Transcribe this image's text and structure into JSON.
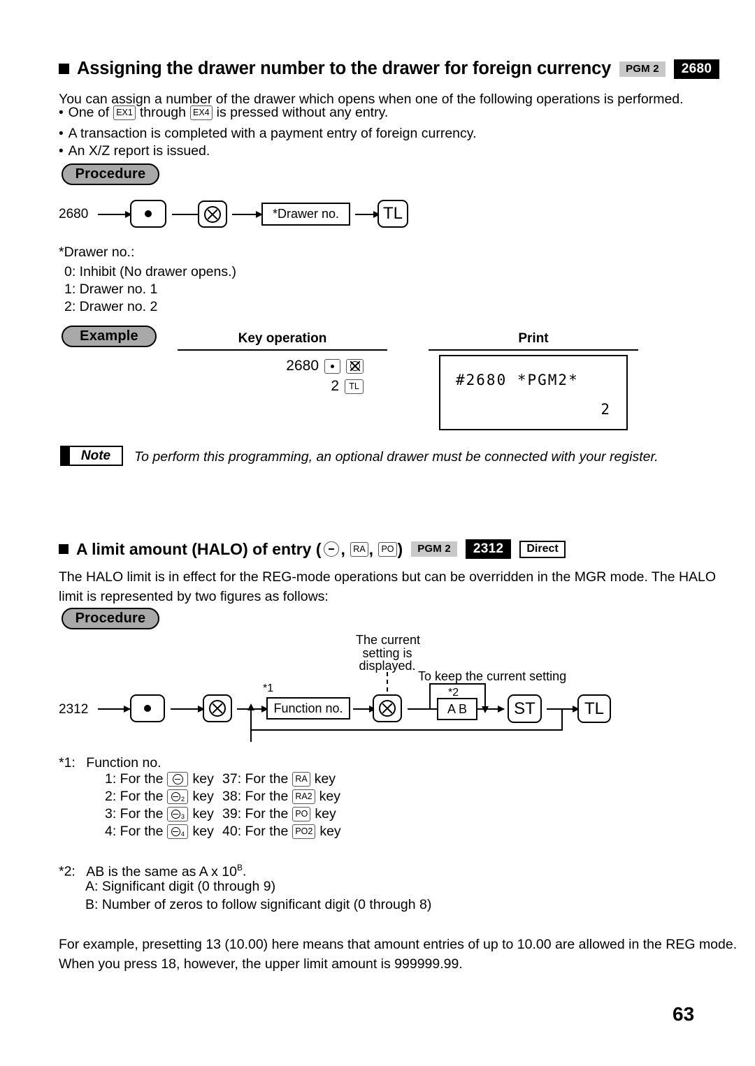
{
  "page": {
    "number": "63"
  },
  "section1": {
    "heading": "Assigning the drawer number to the drawer for foreign currency",
    "badge_mode": "PGM 2",
    "badge_code": "2680",
    "intro": "You can assign a number of the drawer which opens when one of the following operations is performed.",
    "bullets": [
      {
        "pre": "One of",
        "key1": "EX1",
        "mid": "through",
        "key2": "EX4",
        "post": "is pressed without any entry."
      },
      {
        "pre": "A transaction is completed with a payment entry of foreign currency."
      },
      {
        "pre": "An X/Z report is issued."
      }
    ],
    "procedure_label": "Procedure",
    "flow": {
      "start": "2680",
      "node_dot": "dot-key",
      "node_multiply": "multiply-key",
      "node_entry": "*Drawer no.",
      "node_tl": "TL"
    },
    "drawer_note_title": "*Drawer no.:",
    "drawer_options": [
      "0: Inhibit (No drawer opens.)",
      "1: Drawer no. 1",
      "2: Drawer no. 2"
    ],
    "example_label": "Example",
    "col_key_operation": "Key operation",
    "col_print": "Print",
    "key_operation": {
      "row1_value": "2680",
      "row1_key1": "•",
      "row1_key2": "⊗",
      "row2_value": "2",
      "row2_key1": "TL"
    },
    "print": {
      "line1": "#2680 *PGM2*",
      "line2": "2"
    },
    "note_label": "Note",
    "note_text": "To perform this programming, an optional drawer must be connected with your register."
  },
  "section2": {
    "heading_pre": "A limit amount (HALO) of entry (",
    "heading_keys": [
      "minus-key",
      "RA",
      "PO"
    ],
    "heading_post": ")",
    "badge_mode": "PGM 2",
    "badge_code": "2312",
    "badge_direct": "Direct",
    "intro_line1": "The HALO limit is in effect for the REG-mode operations but can be overridden in the MGR mode. The HALO",
    "intro_line2": "limit is represented by two figures as follows:",
    "procedure_label": "Procedure",
    "flow": {
      "start": "2312",
      "annotation_current": [
        "The current",
        "setting is",
        "displayed."
      ],
      "annotation_keep": "To keep the current setting",
      "mark1": "*1",
      "mark2": "*2",
      "node_function": "Function no.",
      "node_ab": "A B",
      "node_st": "ST",
      "node_tl": "TL"
    },
    "fn_title_mark": "*1:",
    "fn_title": "Function no.",
    "fn_left": [
      {
        "num": "1: For the",
        "key": "minus",
        "sub": "",
        "tail": "key"
      },
      {
        "num": "2: For the",
        "key": "minus",
        "sub": "2",
        "tail": "key"
      },
      {
        "num": "3: For the",
        "key": "minus",
        "sub": "3",
        "tail": "key"
      },
      {
        "num": "4: For the",
        "key": "minus",
        "sub": "4",
        "tail": "key"
      }
    ],
    "fn_right": [
      {
        "num": "37: For the",
        "key": "RA",
        "tail": "key"
      },
      {
        "num": "38: For the",
        "key": "RA2",
        "tail": "key"
      },
      {
        "num": "39: For the",
        "key": "PO",
        "tail": "key"
      },
      {
        "num": "40: For the",
        "key": "PO2",
        "tail": "key"
      }
    ],
    "ab_mark": "*2:",
    "ab_line1_pre": "AB is the same as A x 10",
    "ab_line1_sup": "B",
    "ab_line1_post": ".",
    "ab_line2": "A: Significant digit (0 through 9)",
    "ab_line3": "B: Number of zeros to follow significant digit (0 through 8)",
    "example_line1": "For example, presetting 13 (10.00) here means that amount entries of up to 10.00 are allowed in the REG mode.",
    "example_line2": "When you press 18, however, the upper limit amount is 999999.99."
  },
  "colors": {
    "badge_mode_bg": "#c8c8c8",
    "badge_code_bg": "#000000",
    "pill_bg": "#a9a9a9"
  }
}
